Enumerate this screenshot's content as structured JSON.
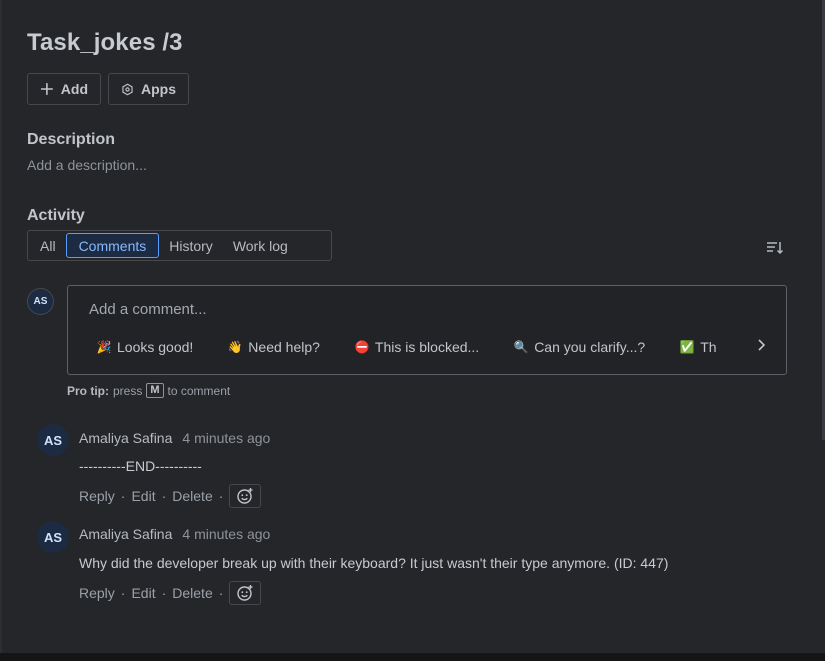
{
  "issue": {
    "title": "Task_jokes /3"
  },
  "toolbar": {
    "add_label": "Add",
    "apps_label": "Apps"
  },
  "description": {
    "heading": "Description",
    "placeholder": "Add a description..."
  },
  "activity": {
    "heading": "Activity",
    "tabs": [
      {
        "label": "All",
        "active": false
      },
      {
        "label": "Comments",
        "active": true
      },
      {
        "label": "History",
        "active": false
      },
      {
        "label": "Work log",
        "active": false
      }
    ]
  },
  "composer": {
    "avatar_initials": "AS",
    "placeholder": "Add a comment...",
    "quick_replies": [
      {
        "emoji": "🎉",
        "label": "Looks good!"
      },
      {
        "emoji": "👋",
        "label": "Need help?"
      },
      {
        "emoji": "⛔",
        "label": "This is blocked..."
      },
      {
        "emoji": "🔍",
        "label": "Can you clarify...?"
      },
      {
        "emoji": "✅",
        "label": "Th"
      }
    ],
    "pro_tip_prefix": "Pro tip:",
    "pro_tip_press": "press",
    "pro_tip_key": "M",
    "pro_tip_suffix": "to comment"
  },
  "comments": [
    {
      "initials": "AS",
      "author": "Amaliya Safina",
      "time": "4 minutes ago",
      "body": "----------END----------",
      "actions": {
        "reply": "Reply",
        "edit": "Edit",
        "delete": "Delete"
      }
    },
    {
      "initials": "AS",
      "author": "Amaliya Safina",
      "time": "4 minutes ago",
      "body": "Why did the developer break up with their keyboard? It just wasn't their type anymore. (ID: 447)",
      "actions": {
        "reply": "Reply",
        "edit": "Edit",
        "delete": "Delete"
      }
    }
  ],
  "colors": {
    "accent": "#579dff",
    "background": "#25262a",
    "avatar": "#1c2b41"
  }
}
